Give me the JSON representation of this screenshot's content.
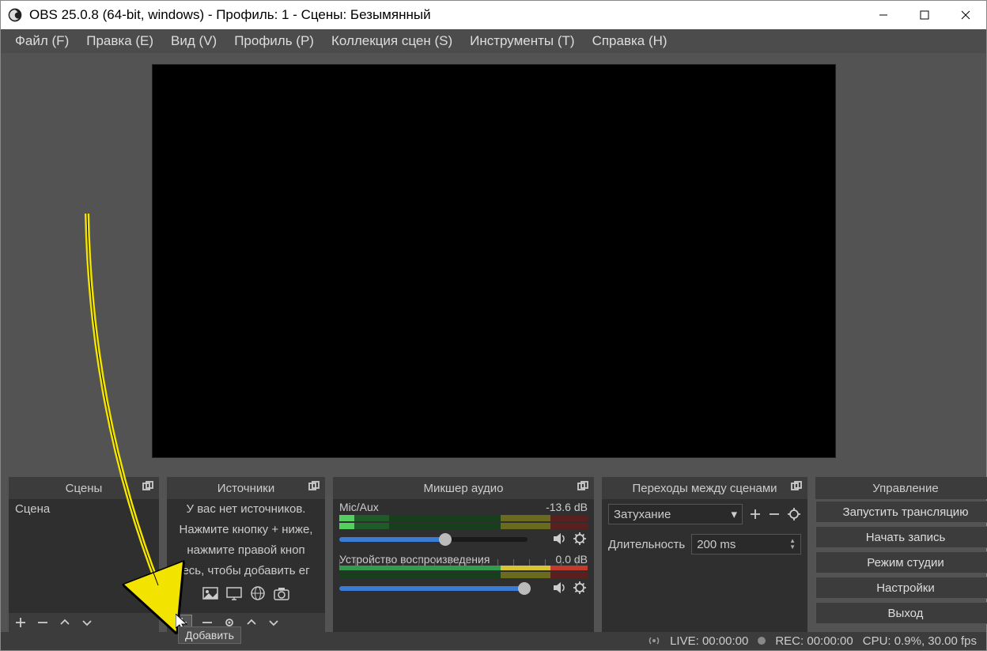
{
  "window": {
    "title": "OBS 25.0.8 (64-bit, windows) - Профиль: 1 - Сцены: Безымянный"
  },
  "menu": {
    "file": "Файл (F)",
    "edit": "Правка (E)",
    "view": "Вид (V)",
    "profile": "Профиль (P)",
    "collection": "Коллекция сцен (S)",
    "tools": "Инструменты (T)",
    "help": "Справка (H)"
  },
  "panels": {
    "scenes": "Сцены",
    "sources": "Источники",
    "mixer": "Микшер аудио",
    "transitions": "Переходы между сценами",
    "controls": "Управление"
  },
  "scenes": {
    "items": [
      "Сцена"
    ]
  },
  "sources": {
    "placeholder_line1": "У вас нет источников.",
    "placeholder_line2": "Нажмите кнопку + ниже,",
    "placeholder_line3": "нажмите правой кноп",
    "placeholder_line4": "есь, чтобы добавить ег"
  },
  "mixer": {
    "ch1_name": "Mic/Aux",
    "ch1_db": "-13.6 dB",
    "ch2_name": "Устройство воспроизведения",
    "ch2_db": "0.0 dB",
    "ticks": "-60 -55 -50 -45 -40 -35 -30 -25 -20 -15 -10 -5 0"
  },
  "transitions": {
    "selected": "Затухание",
    "duration_label": "Длительность",
    "duration_value": "200 ms"
  },
  "controls": {
    "stream": "Запустить трансляцию",
    "record": "Начать запись",
    "studio": "Режим студии",
    "settings": "Настройки",
    "exit": "Выход"
  },
  "status": {
    "live": "LIVE: 00:00:00",
    "rec": "REC: 00:00:00",
    "cpu": "CPU: 0.9%, 30.00 fps"
  },
  "tooltip": "Добавить",
  "icons": {
    "plus": "plus-icon",
    "minus": "minus-icon",
    "gear": "gear-icon",
    "up": "chevron-up-icon",
    "down": "chevron-down-icon",
    "image": "image-icon",
    "monitor": "monitor-icon",
    "globe": "globe-icon",
    "camera": "camera-icon",
    "speaker": "speaker-icon",
    "popout": "popout-icon"
  }
}
